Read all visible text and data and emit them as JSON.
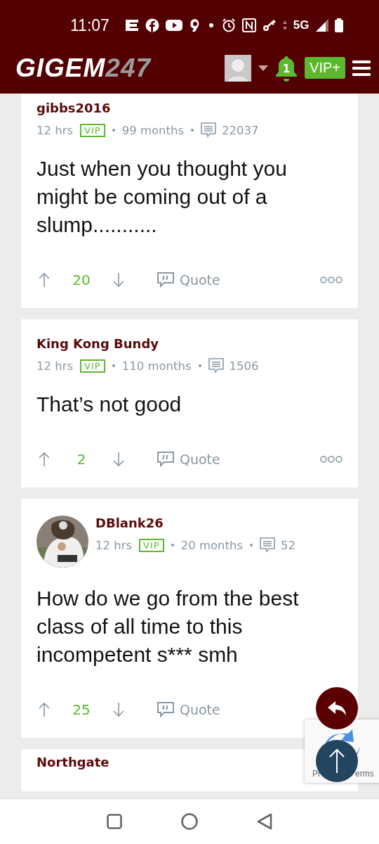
{
  "status_bar": {
    "time": "11:07",
    "network": "5G"
  },
  "header": {
    "logo_main": "GIGEM",
    "logo_suffix": "247",
    "notification_count": "1",
    "vip_button": "VIP+"
  },
  "posts": [
    {
      "author": "gibbs2016",
      "avatar": false,
      "time": "12 hrs",
      "badge": "VIP",
      "tenure": "99 months",
      "post_count": "22037",
      "body": "Just when you thought you might be coming out of a slump...........",
      "upvotes": "20",
      "quote": "Quote",
      "more_menu": true
    },
    {
      "author": "King Kong Bundy",
      "avatar": false,
      "time": "12 hrs",
      "badge": "VIP",
      "tenure": "110 months",
      "post_count": "1506",
      "body": "That’s not good",
      "upvotes": "2",
      "quote": "Quote",
      "more_menu": true
    },
    {
      "author": "DBlank26",
      "avatar": true,
      "time": "12 hrs",
      "badge": "VIP",
      "tenure": "20 months",
      "post_count": "52",
      "body": "How do we go from the best class of all time to this incompetent s*** smh",
      "upvotes": "25",
      "quote": "Quote",
      "more_menu": false
    },
    {
      "author": "Northgate",
      "avatar": false
    }
  ],
  "recaptcha": {
    "text_left": "Pr",
    "text_right": "erms"
  }
}
